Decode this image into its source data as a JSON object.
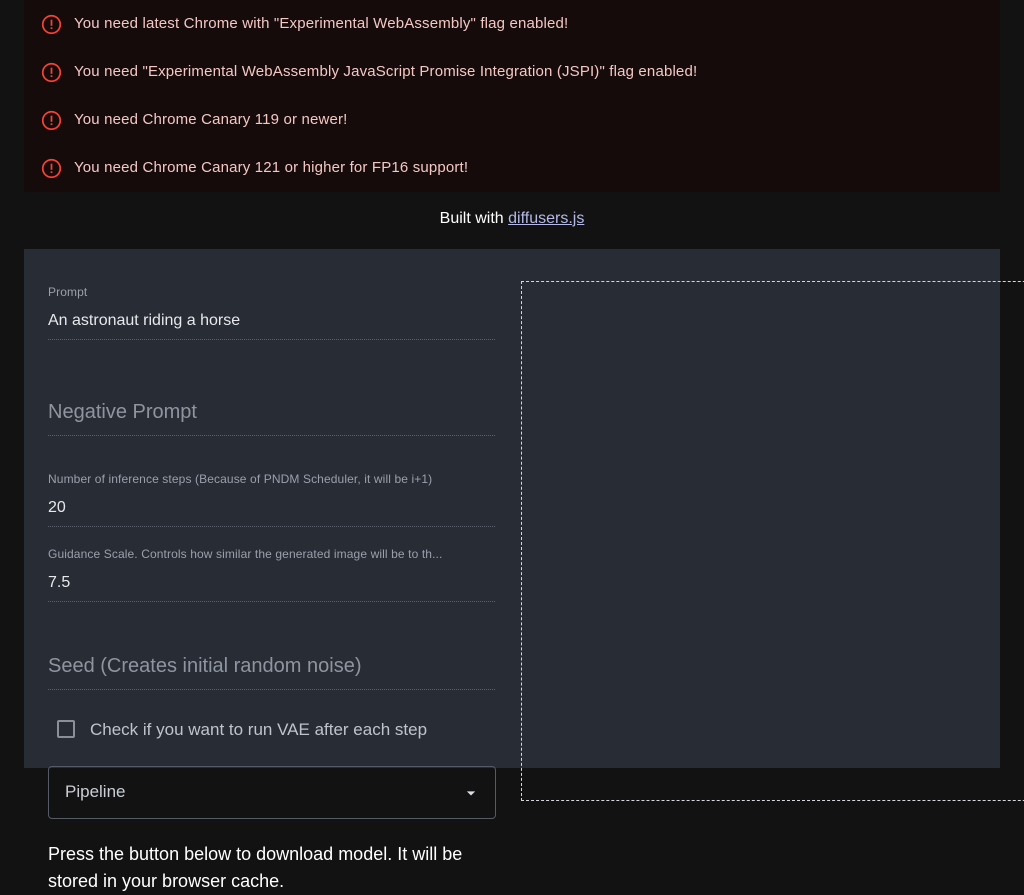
{
  "alerts": {
    "icon_name": "error-circle-icon",
    "icon_color": "#f44336",
    "background": "#160b0b",
    "text_color": "#f4c7c3",
    "items": [
      {
        "message": "You need latest Chrome with \"Experimental WebAssembly\" flag enabled!"
      },
      {
        "message": "You need \"Experimental WebAssembly JavaScript Promise Integration (JSPI)\" flag enabled!"
      },
      {
        "message": "You need Chrome Canary 119 or newer!"
      },
      {
        "message": "You need Chrome Canary 121 or higher for FP16 support!"
      }
    ]
  },
  "attribution": {
    "prefix": "Built with ",
    "link_text": "diffusers.js",
    "link_color": "#b4b9e8"
  },
  "form": {
    "prompt": {
      "label": "Prompt",
      "value": "An astronaut riding a horse"
    },
    "negative_prompt": {
      "placeholder": "Negative Prompt",
      "value": ""
    },
    "inference_steps": {
      "label": "Number of inference steps (Because of PNDM Scheduler, it will be i+1)",
      "value": "20"
    },
    "guidance_scale": {
      "label": "Guidance Scale. Controls how similar the generated image will be to th...",
      "value": "7.5"
    },
    "seed": {
      "placeholder": "Seed (Creates initial random noise)",
      "value": ""
    },
    "vae_checkbox": {
      "label": "Check if you want to run VAE after each step",
      "checked": false
    },
    "pipeline_select": {
      "value": "Pipeline",
      "arrow_icon": "chevron-down-icon"
    },
    "download_helper": "Press the button below to download model. It will be stored in your browser cache."
  },
  "theme": {
    "page_background": "#121212",
    "panel_background": "#282c35",
    "output_border": "#d5d7dc"
  }
}
